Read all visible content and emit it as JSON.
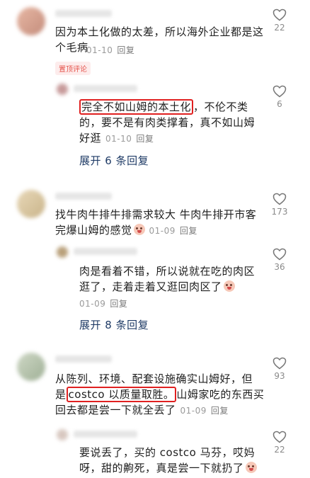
{
  "comments": [
    {
      "text": "因为本土化做的太差，所以海外企业都是这个毛病",
      "line1": "因为本土化做的太差，所以海外企业都是这",
      "line2": "个毛病",
      "date": "01-10",
      "reply": "回复",
      "likes": "22",
      "pinned_label": "置顶评论",
      "replies": [
        {
          "highlight": "完全不如山姆的本土化",
          "line1_rest": "，不伦不类",
          "line2": "的，要不是有肉类撑着，真不如山姆",
          "line3": "好逛",
          "date": "01-10",
          "reply": "回复",
          "likes": "6"
        }
      ],
      "expand_label": "展开 6 条回复"
    },
    {
      "line1": "找牛肉牛排牛排需求较大 牛肉牛排开市客",
      "line2": "完爆山姆的感觉",
      "date": "01-09",
      "reply": "回复",
      "likes": "173",
      "replies": [
        {
          "line1": "肉是看着不错，所以说就在吃的肉区",
          "line2": "逛了，走着走着又逛回肉区了",
          "date": "01-09",
          "reply": "回复",
          "likes": "36"
        }
      ],
      "expand_label": "展开 8 条回复"
    },
    {
      "line1": "从陈列、环境、配套设施确实山姆好，但",
      "line2_pre": "是",
      "highlight": "costco 以质量取胜。",
      "line2_post": "山姆家吃的东西买",
      "line3": "回去都是尝一下就全丢了",
      "date": "01-09",
      "reply": "回复",
      "likes": "93",
      "replies": [
        {
          "line1": "要说丢了，买的 costco 马芬，哎妈",
          "line2": "呀，甜的齁死，真是尝一下就扔了",
          "likes": "22"
        }
      ]
    }
  ]
}
